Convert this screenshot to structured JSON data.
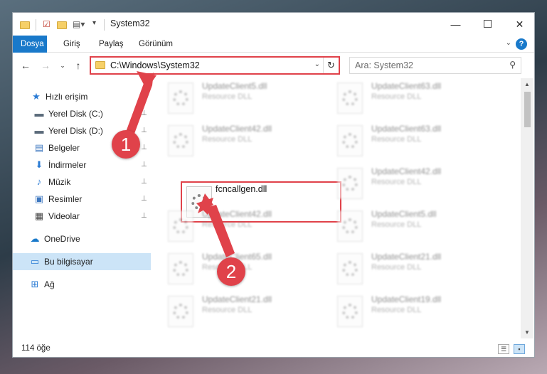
{
  "window": {
    "title": "System32",
    "controls": {
      "minimize": "—",
      "maximize": "☐",
      "close": "✕"
    }
  },
  "ribbon": {
    "tabs": [
      {
        "label": "Dosya",
        "active": true
      },
      {
        "label": "Giriş",
        "active": false
      },
      {
        "label": "Paylaş",
        "active": false
      },
      {
        "label": "Görünüm",
        "active": false
      }
    ],
    "help": "?"
  },
  "navigation": {
    "address": "C:\\Windows\\System32",
    "search_placeholder": "Ara: System32"
  },
  "sidebar": {
    "items": [
      {
        "label": "Hızlı erişim",
        "icon": "star-icon",
        "glyph": "★",
        "color": "#2a7bd4",
        "pinned": false
      },
      {
        "label": "Yerel Disk (C:)",
        "icon": "drive-icon",
        "glyph": "▬",
        "color": "#5a6a7a",
        "pinned": true
      },
      {
        "label": "Yerel Disk (D:)",
        "icon": "drive-icon",
        "glyph": "▬",
        "color": "#5a6a7a",
        "pinned": true
      },
      {
        "label": "Belgeler",
        "icon": "documents-icon",
        "glyph": "▤",
        "color": "#3f78c0",
        "pinned": true
      },
      {
        "label": "İndirmeler",
        "icon": "download-icon",
        "glyph": "⬇",
        "color": "#2a7bd4",
        "pinned": true
      },
      {
        "label": "Müzik",
        "icon": "music-icon",
        "glyph": "♪",
        "color": "#2a7bd4",
        "pinned": true
      },
      {
        "label": "Resimler",
        "icon": "pictures-icon",
        "glyph": "▣",
        "color": "#3f78c0",
        "pinned": true
      },
      {
        "label": "Videolar",
        "icon": "videos-icon",
        "glyph": "▦",
        "color": "#444444",
        "pinned": true
      },
      {
        "label": "OneDrive",
        "icon": "cloud-icon",
        "glyph": "☁",
        "color": "#1979ca",
        "pinned": false
      },
      {
        "label": "Bu bilgisayar",
        "icon": "computer-icon",
        "glyph": "▭",
        "color": "#2a7bd4",
        "pinned": false,
        "selected": true
      },
      {
        "label": "Ağ",
        "icon": "network-icon",
        "glyph": "⊞",
        "color": "#2a7bd4",
        "pinned": false
      }
    ],
    "pin_glyph": "📌"
  },
  "files": [
    {
      "name": "UpdateClient5.dll",
      "type": "Resource DLL"
    },
    {
      "name": "UpdateClient63.dll",
      "type": "Resource DLL"
    },
    {
      "name": "UpdateClient42.dll",
      "type": "Resource DLL"
    },
    {
      "name": "UpdateClient63.dll",
      "type": "Resource DLL"
    },
    {
      "name": "UpdateClient42.dll",
      "type": "Resource DLL"
    },
    {
      "name": "UpdateClient42.dll",
      "type": "Resource DLL"
    },
    {
      "name": "UpdateClient5.dll",
      "type": "Resource DLL"
    },
    {
      "name": "UpdateClient65.dll",
      "type": "Resource DLL"
    },
    {
      "name": "UpdateClient21.dll",
      "type": "Resource DLL"
    },
    {
      "name": "UpdateClient21.dll",
      "type": "Resource DLL"
    },
    {
      "name": "UpdateClient19.dll",
      "type": "Resource DLL"
    }
  ],
  "highlighted_file": {
    "name": "fcncallgen.dll"
  },
  "status": {
    "count": "114 öğe"
  },
  "callouts": [
    {
      "number": "1",
      "target": "address bar"
    },
    {
      "number": "2",
      "target": "fcncallgen.dll"
    }
  ],
  "colors": {
    "accent": "#1979ca",
    "callout": "#e0424a",
    "selected": "#cce4f7"
  }
}
